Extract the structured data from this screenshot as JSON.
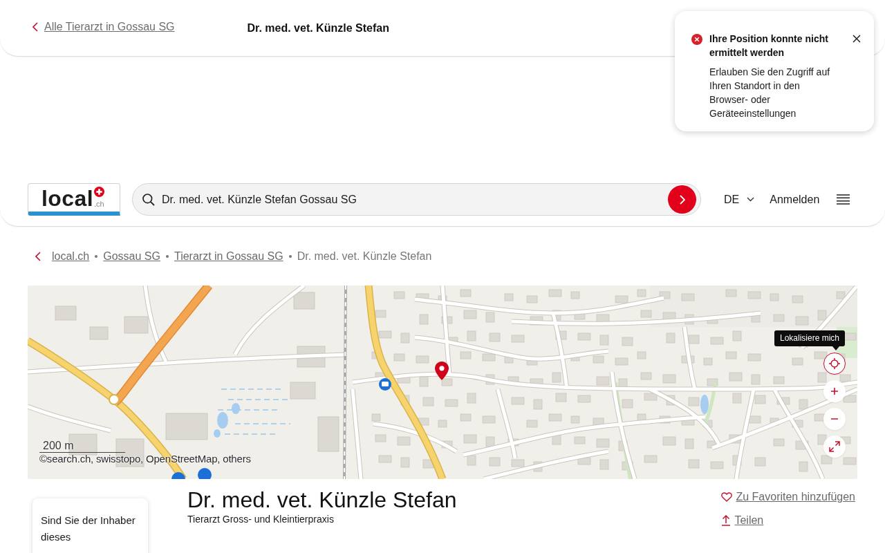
{
  "top_bar": {
    "back_link": "Alle Tierarzt in Gossau SG",
    "title": "Dr. med. vet. Künzle Stefan"
  },
  "toast": {
    "title": "Ihre Position konnte nicht ermittelt werden",
    "message": "Erlauben Sie den Zugriff auf Ihren Standort in den Browser- oder Geräteeinstellungen"
  },
  "header": {
    "logo": {
      "name": "local",
      "suffix": ".ch"
    },
    "search": {
      "value": "Dr. med. vet. Künzle Stefan Gossau SG"
    },
    "language": "DE",
    "login": "Anmelden"
  },
  "breadcrumb": [
    {
      "label": "local.ch",
      "current": false
    },
    {
      "label": "Gossau SG",
      "current": false
    },
    {
      "label": "Tierarzt in Gossau SG",
      "current": false
    },
    {
      "label": "Dr. med. vet. Künzle Stefan",
      "current": true
    }
  ],
  "map": {
    "tooltip": "Lokalisiere mich",
    "scale": "200 m",
    "attribution": "©search.ch, swisstopo, OpenStreetMap, others"
  },
  "listing": {
    "name": "Dr. med. vet. Künzle Stefan",
    "category": "Tierarzt Gross- und Kleintierpraxis",
    "actions": [
      {
        "kind": "favorite",
        "label": "Zu Favoriten hinzufügen"
      },
      {
        "kind": "share",
        "label": "Teilen"
      }
    ]
  },
  "owner_card": {
    "text": "Sind Sie der Inhaber dieses"
  }
}
